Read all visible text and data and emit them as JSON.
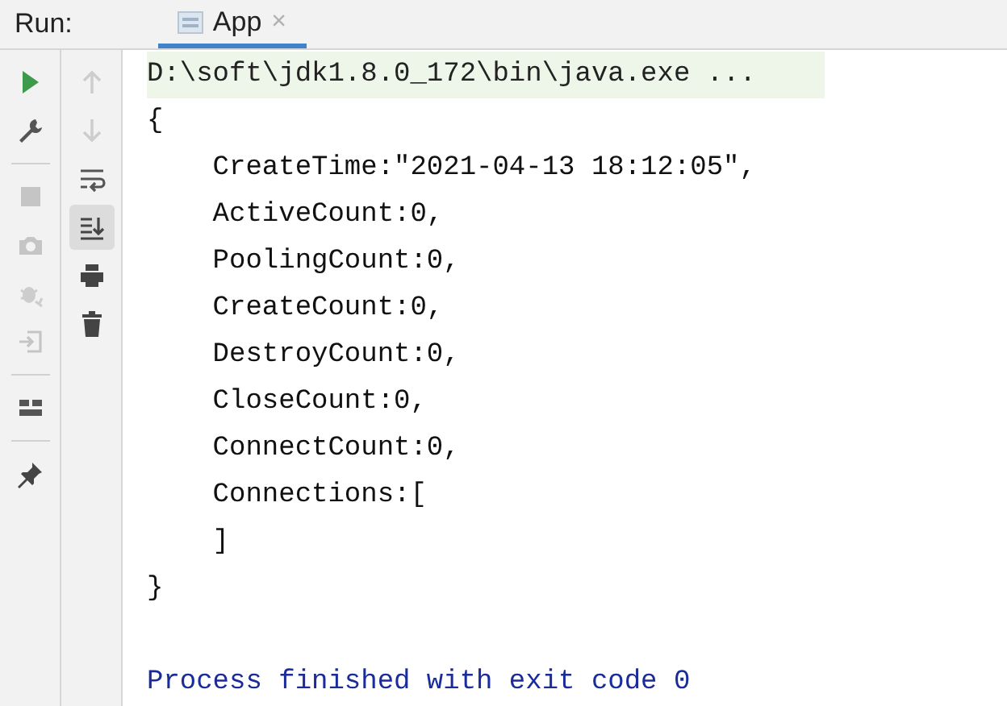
{
  "run_label": "Run:",
  "tabs": [
    {
      "label": "App",
      "selected": true,
      "close": "×"
    }
  ],
  "left_toolbar": [
    {
      "kind": "run",
      "disabled": false
    },
    {
      "kind": "wrench",
      "disabled": false
    },
    {
      "kind": "sep"
    },
    {
      "kind": "stop",
      "disabled": true
    },
    {
      "kind": "camera",
      "disabled": true
    },
    {
      "kind": "bug",
      "disabled": true
    },
    {
      "kind": "login",
      "disabled": true
    },
    {
      "kind": "sep"
    },
    {
      "kind": "layout",
      "disabled": false
    },
    {
      "kind": "sep"
    },
    {
      "kind": "pin",
      "disabled": false
    }
  ],
  "right_toolbar": [
    {
      "kind": "up",
      "disabled": true,
      "selected": false
    },
    {
      "kind": "down",
      "disabled": true,
      "selected": false
    },
    {
      "kind": "wrap",
      "disabled": false,
      "selected": false
    },
    {
      "kind": "scroll-end",
      "disabled": false,
      "selected": true
    },
    {
      "kind": "print",
      "disabled": false,
      "selected": false
    },
    {
      "kind": "trash",
      "disabled": false,
      "selected": false
    }
  ],
  "console": [
    {
      "kind": "command",
      "text": "D:\\soft\\jdk1.8.0_172\\bin\\java.exe ..."
    },
    {
      "kind": "output",
      "text": "{"
    },
    {
      "kind": "output",
      "text": "    CreateTime:\"2021-04-13 18:12:05\","
    },
    {
      "kind": "output",
      "text": "    ActiveCount:0,"
    },
    {
      "kind": "output",
      "text": "    PoolingCount:0,"
    },
    {
      "kind": "output",
      "text": "    CreateCount:0,"
    },
    {
      "kind": "output",
      "text": "    DestroyCount:0,"
    },
    {
      "kind": "output",
      "text": "    CloseCount:0,"
    },
    {
      "kind": "output",
      "text": "    ConnectCount:0,"
    },
    {
      "kind": "output",
      "text": "    Connections:["
    },
    {
      "kind": "output",
      "text": "    ]"
    },
    {
      "kind": "output",
      "text": "}"
    },
    {
      "kind": "blank"
    },
    {
      "kind": "exit",
      "text": "Process finished with exit code 0"
    }
  ]
}
